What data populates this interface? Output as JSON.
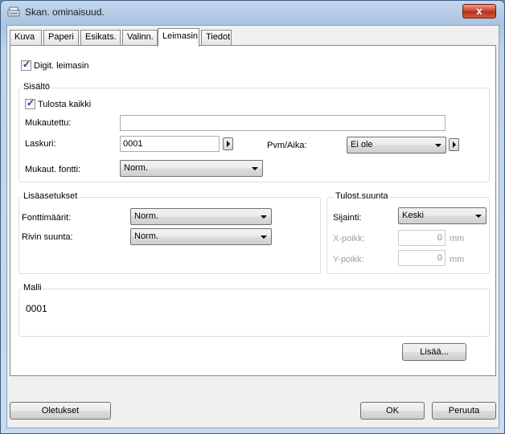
{
  "window": {
    "title": "Skan. ominaisuud.",
    "close_label": "x"
  },
  "tabs": [
    {
      "label": "Kuva"
    },
    {
      "label": "Paperi"
    },
    {
      "label": "Esikats."
    },
    {
      "label": "Valinn."
    },
    {
      "label": "Leimasin"
    },
    {
      "label": "Tiedot"
    }
  ],
  "active_tab": "Leimasin",
  "digital_stamp": {
    "label": "Digit. leimasin",
    "checked": true
  },
  "content": {
    "title": "Sisältö",
    "print_all": {
      "label": "Tulosta kaikki",
      "checked": true
    },
    "custom_label": "Mukautettu:",
    "custom_value": "",
    "counter_label": "Laskuri:",
    "counter_value": "0001",
    "datetime_label": "Pvm/Aika:",
    "datetime_value": "Ei ole",
    "custom_font_label": "Mukaut. fontti:",
    "custom_font_value": "Norm."
  },
  "advanced": {
    "title": "Lisäasetukset",
    "font_attr_label": "Fonttimäärit:",
    "font_attr_value": "Norm.",
    "line_dir_label": "Rivin suunta:",
    "line_dir_value": "Norm."
  },
  "print_dir": {
    "title": "Tulost.suunta",
    "position_label": "Sijainti:",
    "position_value": "Keski",
    "x_label": "X-poikk:",
    "x_value": "0",
    "y_label": "Y-poikk:",
    "y_value": "0",
    "unit": "mm"
  },
  "sample": {
    "title": "Malli",
    "value": "0001"
  },
  "buttons": {
    "add": "Lisää...",
    "defaults": "Oletukset",
    "ok": "OK",
    "cancel": "Peruuta"
  },
  "colors": {
    "title_bar": "#b9cfe8",
    "close": "#c7402a",
    "dialog_bg": "#f0f0f0"
  }
}
